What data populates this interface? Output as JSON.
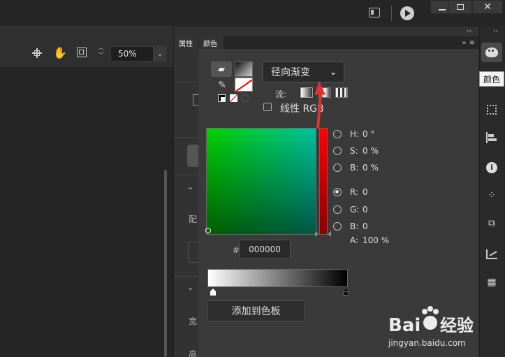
{
  "toolbar": {
    "zoom_value": "50%"
  },
  "panel_tabs": {
    "properties": "属性",
    "color": "颜色"
  },
  "properties_fragments": {
    "match": "配",
    "width": "宽",
    "height": "高"
  },
  "color_panel": {
    "fill_type": "径向渐变",
    "flow_label": "流:",
    "linear_rgb_label": "线性 RGB",
    "linear_rgb_checked": false,
    "channels": [
      {
        "name": "H:",
        "value": "0 °",
        "selected": false
      },
      {
        "name": "S:",
        "value": "0 %",
        "selected": false
      },
      {
        "name": "B:",
        "value": "0 %",
        "selected": false
      },
      {
        "name": "R:",
        "value": "0",
        "selected": true
      },
      {
        "name": "G:",
        "value": "0",
        "selected": false
      },
      {
        "name": "B:",
        "value": "0",
        "selected": false
      }
    ],
    "alpha_label": "A:",
    "alpha_value": "100 %",
    "hex_hash": "#",
    "hex_value": "000000",
    "gradient_start_color": "#ffffff",
    "gradient_end_color": "#000000",
    "add_swatch_label": "添加到色板"
  },
  "dock": {
    "tooltip": "颜色"
  },
  "watermark": {
    "text": "jingyan.baidu.com",
    "logo_text": "Baidu 经验"
  },
  "colors": {
    "hue_selected": "#ff0000",
    "arrow": "#e53030"
  }
}
